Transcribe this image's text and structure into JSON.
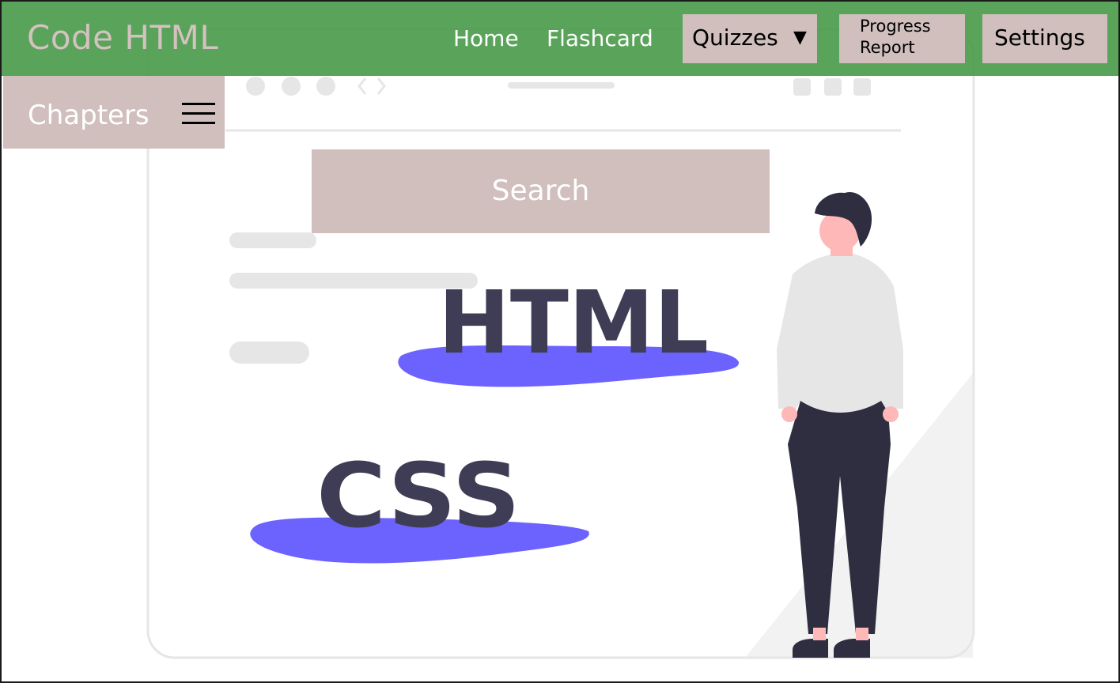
{
  "header": {
    "brand": "Code HTML",
    "nav": {
      "home": "Home",
      "flashcard": "Flashcard",
      "quizzes": "Quizzes",
      "quizzes_caret": "▼",
      "progress_report": "Progress\nReport",
      "settings": "Settings"
    }
  },
  "sidebar": {
    "chapters_label": "Chapters",
    "menu_icon": "hamburger-icon"
  },
  "search": {
    "label": "Search"
  },
  "illustration": {
    "html_badge": "HTML",
    "css_badge": "CSS"
  },
  "colors": {
    "navbar": "#489948",
    "button_bg": "#d0bfbd",
    "brand_text": "#d4c2c0",
    "accent_blob": "#6c63ff",
    "dark_text": "#3f3d56"
  }
}
